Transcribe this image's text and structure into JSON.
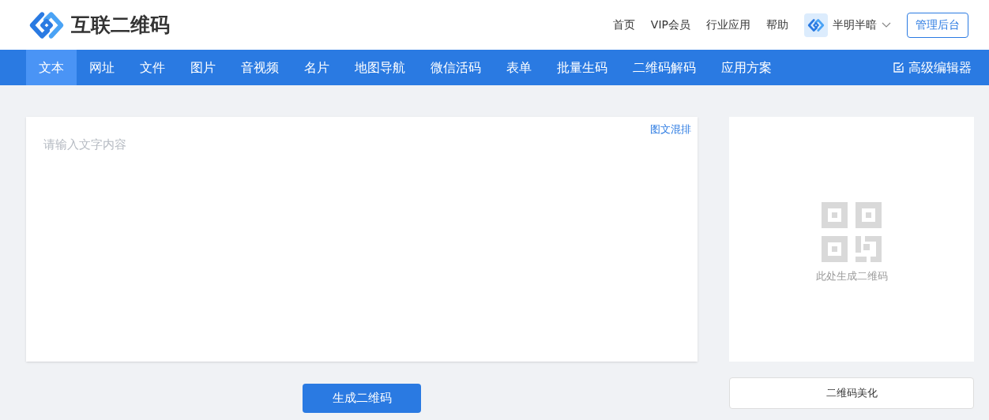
{
  "header": {
    "logo_text": "互联二维码",
    "links": [
      "首页",
      "VIP会员",
      "行业应用",
      "帮助"
    ],
    "user": {
      "name": "半明半暗"
    },
    "admin_button": "管理后台"
  },
  "nav": {
    "tabs": [
      {
        "label": "文本",
        "selected": true
      },
      {
        "label": "网址",
        "selected": false
      },
      {
        "label": "文件",
        "selected": false
      },
      {
        "label": "图片",
        "selected": false
      },
      {
        "label": "音视频",
        "selected": false
      },
      {
        "label": "名片",
        "selected": false
      },
      {
        "label": "地图导航",
        "selected": false
      },
      {
        "label": "微信活码",
        "selected": false
      },
      {
        "label": "表单",
        "selected": false
      },
      {
        "label": "批量生码",
        "selected": false
      },
      {
        "label": "二维码解码",
        "selected": false
      },
      {
        "label": "应用方案",
        "selected": false
      }
    ],
    "editor_link": "高级编辑器"
  },
  "editor": {
    "placeholder": "请输入文字内容",
    "mix_link": "图文混排",
    "generate_button": "生成二维码"
  },
  "preview": {
    "hint": "此处生成二维码",
    "beautify_button": "二维码美化"
  }
}
